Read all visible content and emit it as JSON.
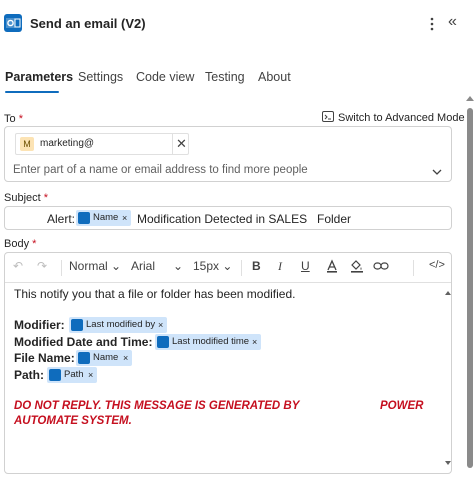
{
  "header": {
    "title": "Send an email (V2)",
    "more_icon": "more-vertical-icon",
    "collapse_icon": "double-chevron-left-icon",
    "collapse_glyph": "«",
    "app_icon": "outlook-icon"
  },
  "tabs": [
    {
      "label": "Parameters",
      "active": true
    },
    {
      "label": "Settings"
    },
    {
      "label": "Code view"
    },
    {
      "label": "Testing"
    },
    {
      "label": "About"
    }
  ],
  "to": {
    "label": "To",
    "required_mark": "*",
    "advanced_mode_label": "Switch to Advanced Mode",
    "chip": {
      "avatar": "M",
      "text": "marketing@",
      "close": "✕"
    },
    "placeholder": "Enter part of a name or email address to find more people"
  },
  "subject": {
    "label": "Subject",
    "required_mark": "*",
    "prefix": "Alert:",
    "token": {
      "text": "Name",
      "close": "×"
    },
    "middle": "Modification Detected in SALES",
    "suffix": "Folder"
  },
  "body": {
    "label": "Body",
    "required_mark": "*",
    "toolbar": {
      "undo": "↶",
      "redo": "↷",
      "style": "Normal",
      "font": "Arial",
      "size": "15px",
      "bold": "B",
      "italic": "I",
      "underline": "U",
      "code": "</>"
    },
    "intro": "This notify you that a file or folder has been modified.",
    "fields": [
      {
        "label": "Modifier:",
        "token": "Last modified by"
      },
      {
        "label": "Modified Date and Time:",
        "token": "Last modified time"
      },
      {
        "label": "File Name:",
        "token": "Name"
      },
      {
        "label": "Path:",
        "token": "Path"
      }
    ],
    "token_close": "×",
    "warning_line1": "DO NOT REPLY. THIS MESSAGE IS GENERATED BY",
    "warning_line1_end": "POWER",
    "warning_line2": "AUTOMATE SYSTEM."
  },
  "colors": {
    "accent": "#0f6cbd",
    "required": "#c50f1f",
    "token_bg": "#cfe4fa"
  }
}
